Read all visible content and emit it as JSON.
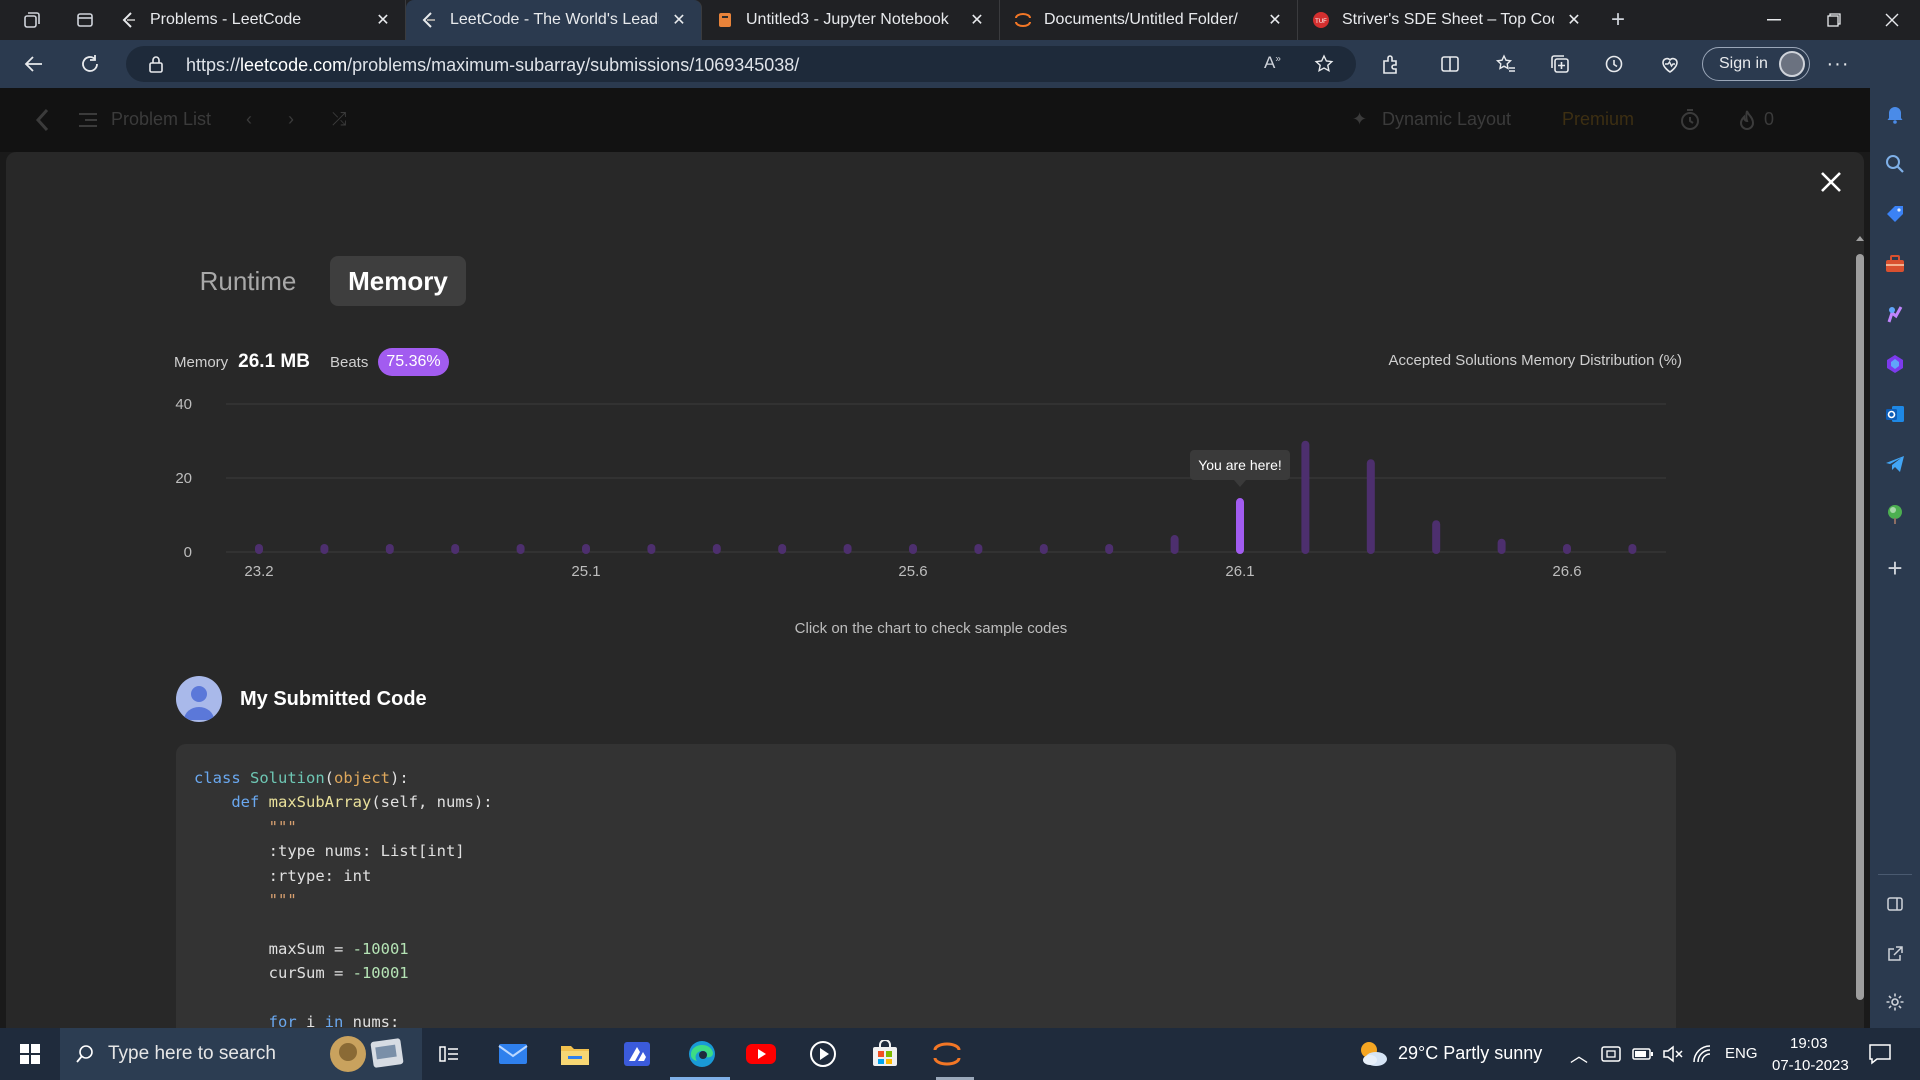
{
  "browser": {
    "tabs": [
      {
        "title": "Problems - LeetCode",
        "active": false
      },
      {
        "title": "LeetCode - The World's Leading",
        "active": true
      },
      {
        "title": "Untitled3 - Jupyter Notebook",
        "active": false
      },
      {
        "title": "Documents/Untitled Folder/",
        "active": false
      },
      {
        "title": "Striver's SDE Sheet – Top Coding",
        "active": false
      }
    ],
    "url_scheme": "https://",
    "url_host": "leetcode.com",
    "url_path": "/problems/maximum-subarray/submissions/1069345038/",
    "sign_in_label": "Sign in"
  },
  "leetcode_header": {
    "problem_list_label": "Problem List",
    "dynamic_layout_label": "Dynamic Layout",
    "premium_label": "Premium",
    "streak_count": "0"
  },
  "stats_panel": {
    "tabs": [
      "Runtime",
      "Memory"
    ],
    "selected_tab": "Memory",
    "metric_label": "Memory",
    "metric_value": "26.1 MB",
    "beats_label": "Beats",
    "beats_value": "75.36%",
    "distribution_title": "Accepted Solutions Memory Distribution (%)",
    "hint": "Click on the chart to check sample codes",
    "marker_label": "You are here!"
  },
  "chart_data": {
    "type": "bar",
    "title": "Accepted Solutions Memory Distribution (%)",
    "ylabel": "",
    "xlabel": "",
    "ylim": [
      0,
      40
    ],
    "yticks": [
      "0",
      "20",
      "40"
    ],
    "xtick_labels": [
      "23.2",
      "25.1",
      "25.6",
      "26.1",
      "26.6"
    ],
    "xtick_bar_index": [
      0,
      5,
      10,
      15,
      20
    ],
    "values": [
      0.1,
      0.1,
      0.1,
      0.1,
      0.1,
      0.1,
      0.1,
      0.1,
      0.1,
      0.1,
      0.1,
      0.1,
      0.1,
      0.1,
      3.5,
      13.5,
      29,
      24,
      7.5,
      2.5,
      0.1,
      0.1
    ],
    "highlight_index": 15,
    "colors": {
      "bar": "#4d2f6e",
      "highlight": "#a25cf0",
      "grid": "#3d3d3d",
      "axis_text": "#bdbdbd"
    }
  },
  "submission": {
    "title": "My Submitted Code"
  },
  "taskbar": {
    "search_placeholder": "Type here to search",
    "weather": "29°C  Partly sunny",
    "language": "ENG",
    "time": "19:03",
    "date": "07-10-2023"
  }
}
